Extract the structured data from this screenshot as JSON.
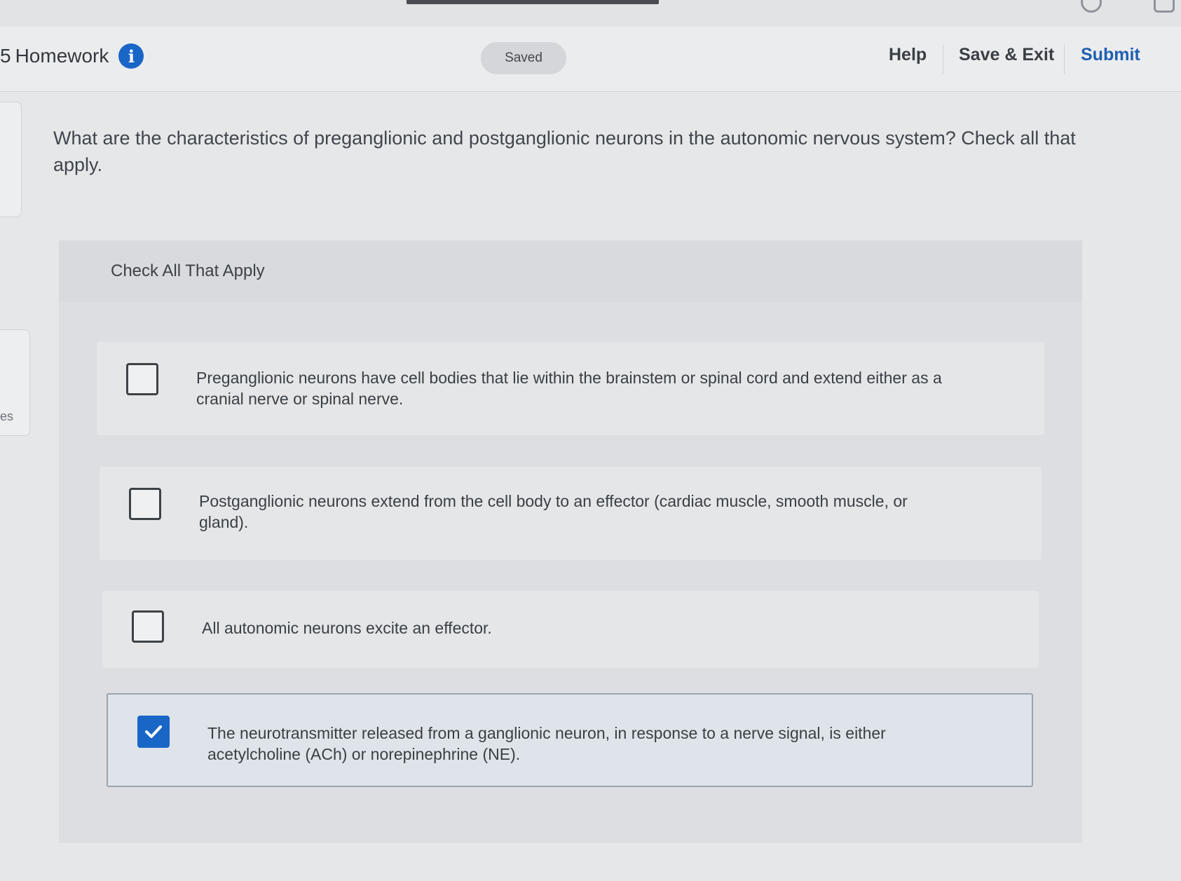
{
  "header": {
    "title_prefix": "5",
    "title": "Homework",
    "info_glyph": "i",
    "saved_status": "Saved",
    "help_label": "Help",
    "save_exit_label": "Save & Exit",
    "submit_label": "Submit"
  },
  "side_panel": {
    "label_fragment": "es"
  },
  "question": {
    "text": "What are the characteristics of preganglionic and postganglionic neurons in the autonomic nervous system?  Check all that apply."
  },
  "answer_panel": {
    "title": "Check All That Apply",
    "options": [
      {
        "text": "Preganglionic neurons have cell bodies that lie within the brainstem or spinal cord and extend either as a cranial nerve or spinal nerve.",
        "checked": false
      },
      {
        "text": "Postganglionic neurons extend from the cell body to an effector (cardiac muscle, smooth muscle, or gland).",
        "checked": false
      },
      {
        "text": "All autonomic neurons excite an effector.",
        "checked": false
      },
      {
        "text": "The neurotransmitter released from a ganglionic neuron, in response to a nerve signal, is either acetylcholine (ACh) or norepinephrine (NE).",
        "checked": true
      }
    ]
  },
  "colors": {
    "accent": "#1a66c7",
    "submit": "#1f5fb0"
  },
  "icons": {
    "info": "info-icon",
    "check": "checkmark-icon"
  }
}
